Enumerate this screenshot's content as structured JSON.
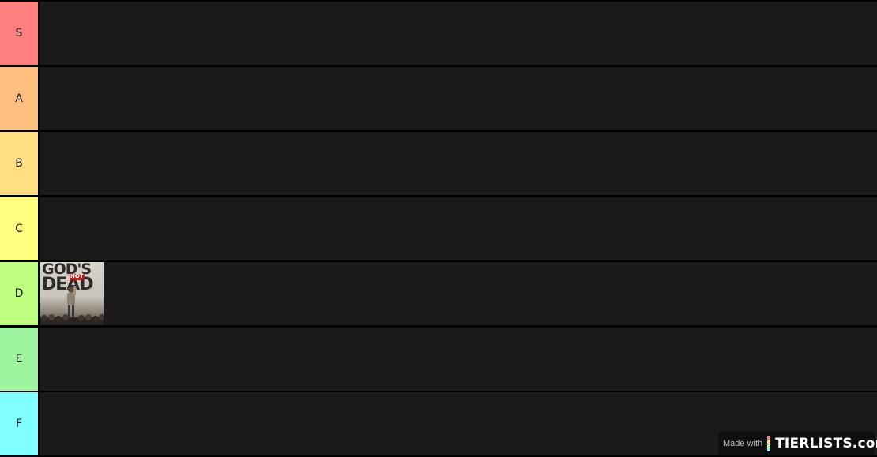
{
  "tiers": [
    {
      "label": "S",
      "color": "#ff7f7f"
    },
    {
      "label": "A",
      "color": "#ffbf7f"
    },
    {
      "label": "B",
      "color": "#ffdf7f"
    },
    {
      "label": "C",
      "color": "#ffff7f"
    },
    {
      "label": "D",
      "color": "#bfff7f"
    },
    {
      "label": "E",
      "color": "#9ff59f"
    },
    {
      "label": "F",
      "color": "#7fffff"
    }
  ],
  "items_d": [
    {
      "title_line1": "GOD'S",
      "title_line2": "DEAD",
      "overlay": "NOT"
    }
  ],
  "colors": {
    "tier_row_background": "#1a1a1a",
    "separator": "#000000"
  },
  "watermark": {
    "made_with": "Made with",
    "brand": "TIERLISTS.com",
    "mark_colors": [
      "#ff7f7f",
      "#ffdf7f",
      "#bfff7f",
      "#7fffff"
    ]
  }
}
